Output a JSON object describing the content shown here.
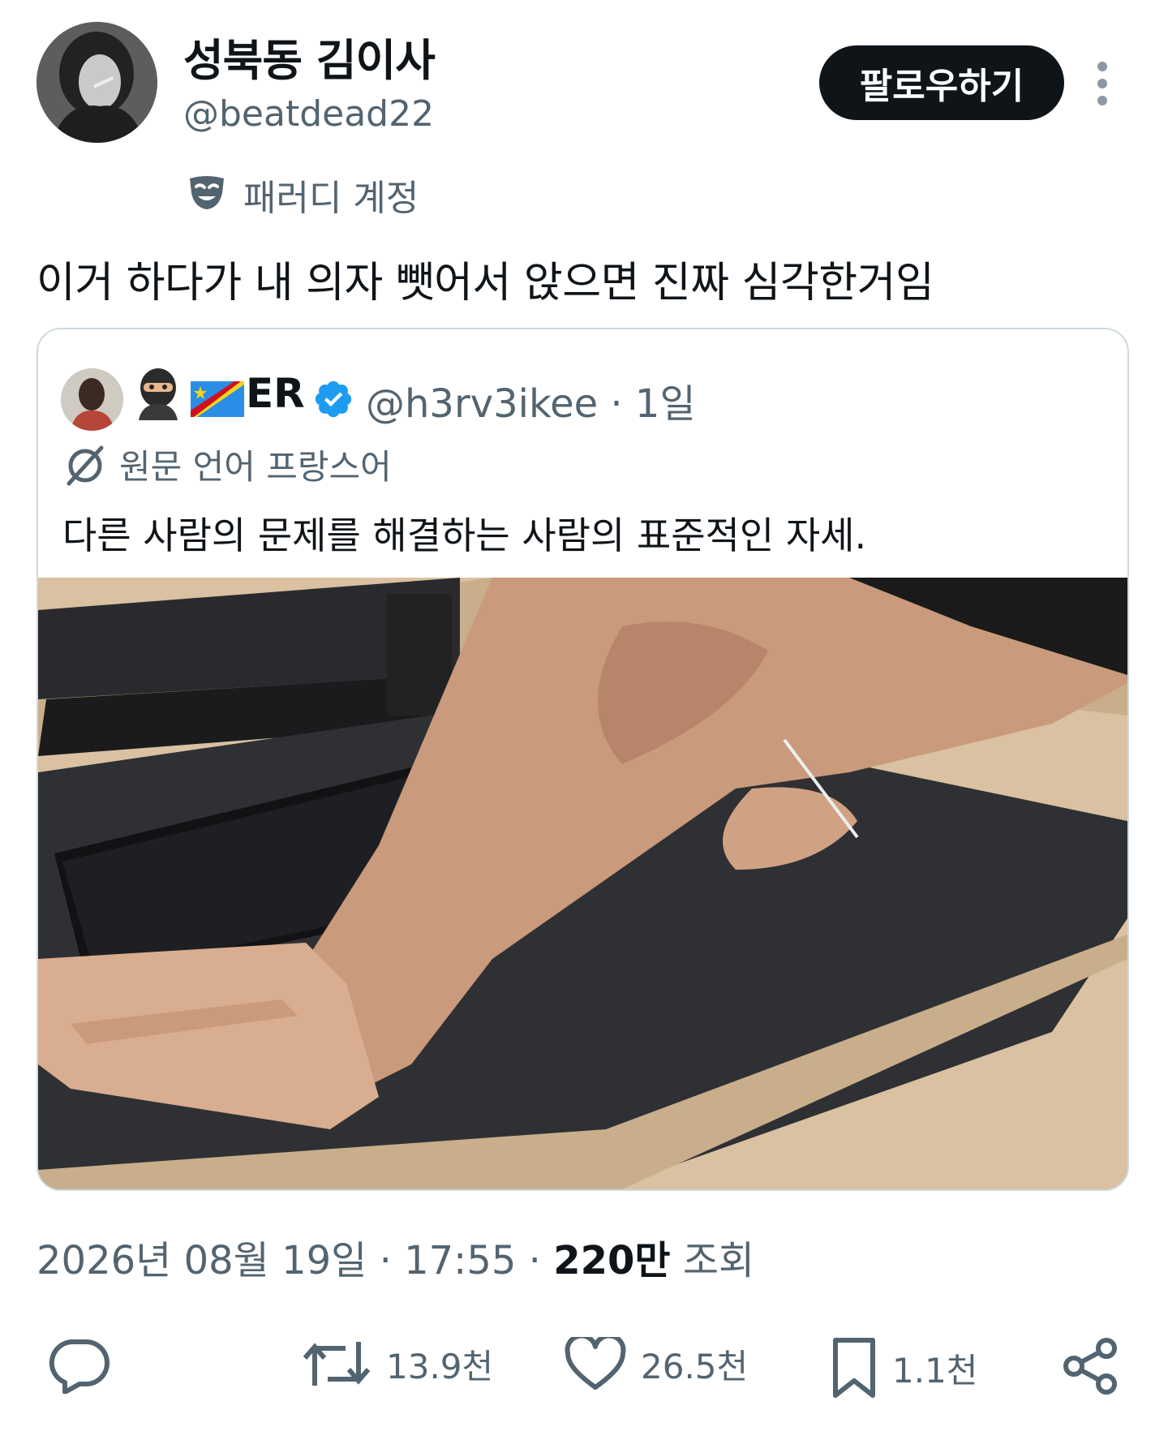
{
  "author": {
    "display_name": "성북동 김이사",
    "handle": "@beatdead22",
    "label": "패러디 계정"
  },
  "follow_label": "팔로우하기",
  "tweet_text": "이거 하다가 내 의자 뺏어서 앉으면 진짜 심각한거임",
  "quote": {
    "name": "ER",
    "handle_time": "@h3rv3ikee · 1일",
    "translation_label": "원문 언어 프랑스어",
    "text": "다른 사람의 문제를 해결하는 사람의 표준적인 자세."
  },
  "meta": {
    "date": "2026년 08월 19일 · 17:55 · ",
    "views": "220만",
    "views_label": "조회"
  },
  "actions": {
    "retweets": "13.9천",
    "likes": "26.5천",
    "bookmarks": "1.1천"
  },
  "icons": [
    "more-icon",
    "parody-mask-icon",
    "verified-badge-icon",
    "translate-icon",
    "reply-icon",
    "retweet-icon",
    "like-icon",
    "bookmark-icon",
    "share-icon"
  ],
  "colors": {
    "text": "#0f1419",
    "secondary": "#536471",
    "verified": "#1d9bf0",
    "border": "#cfd9de"
  }
}
